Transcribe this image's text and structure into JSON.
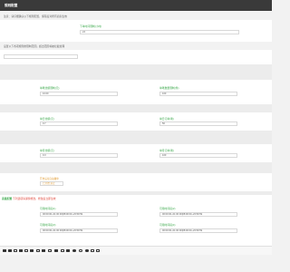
{
  "header": {
    "title": "规则配置"
  },
  "notice": "注意：请仔细确认以下规则配置，保存后对所有商家生效",
  "section1": {
    "label": "下单时间限制(小时)",
    "value": "24"
  },
  "section2": {
    "desc": "设置以下各项规则的限制范围，超出范围将被拦截处理"
  },
  "row_a": {
    "left_label": "单笔金额限制(元)",
    "left_value": "10.00",
    "right_label": "单笔数量限制(件)",
    "right_value": "100"
  },
  "row_b": {
    "left_label": "单日金额(元)",
    "left_value": "0.7",
    "right_label": "单日订单(笔)",
    "right_value": "50"
  },
  "row_c": {
    "left_label": "单月金额(元)",
    "left_value": "0.3",
    "right_label": "单月订单(笔)",
    "right_value": "100"
  },
  "orange_block": {
    "label": "开启后可自动撤单",
    "value": "已开启  禁止"
  },
  "warning": {
    "title": "高级配置",
    "desc": "下列选项请谨慎修改，修改后立即生效"
  },
  "time_fields": [
    {
      "label": "可用时间段(1)",
      "value": "00:00:00~01:00:00|08:00:00~23:59:59"
    },
    {
      "label": "可用时间段(2)",
      "value": "00:00:00~01:00:00|08:00:00~23:59:59"
    },
    {
      "label": "可用时间段(3)",
      "value": "00:00:00~01:00:00|08:00:00~23:59:59"
    },
    {
      "label": "可用时间段(4)",
      "value": "00:00:00~01:00:00|08:00:00~23:59:59"
    }
  ],
  "toolbar": {
    "icons": [
      "font-size-icon",
      "bold-icon",
      "italic-icon",
      "underline-icon",
      "strike-icon",
      "color-icon",
      "link-icon",
      "quote-icon",
      "list-icon",
      "ordered-list-icon",
      "image-icon",
      "table-icon",
      "code-icon",
      "emoji-icon",
      "undo-icon",
      "redo-icon",
      "fullscreen-icon",
      "preview-icon"
    ]
  }
}
